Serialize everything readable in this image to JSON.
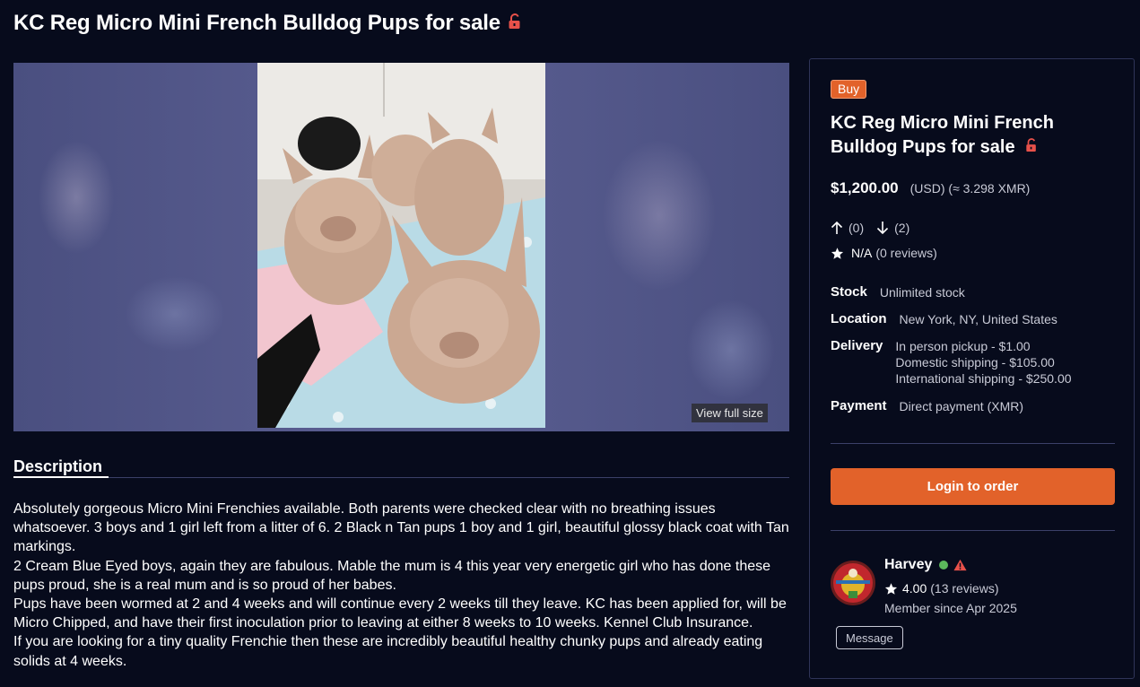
{
  "page": {
    "title": "KC Reg Micro Mini French Bulldog Pups for sale"
  },
  "gallery": {
    "view_full_label": "View full size"
  },
  "description": {
    "tab_label": "Description",
    "lines": [
      "Absolutely gorgeous Micro Mini Frenchies available. Both parents were checked clear with no breathing issues whatsoever. 3 boys and 1 girl left from a litter of 6. 2 Black n Tan pups 1 boy and 1 girl, beautiful glossy black coat with Tan markings.",
      "2 Cream Blue Eyed boys, again they are fabulous. Mable the mum is 4 this year very energetic girl who has done these pups proud, she is a real mum and is so proud of her babes.",
      "Pups have been wormed at 2 and 4 weeks and will continue every 2 weeks till they leave. KC has been applied for, will be Micro Chipped, and have their first inoculation prior to leaving at either 8 weeks to 10 weeks. Kennel Club Insurance.",
      "If you are looking for a tiny quality Frenchie then these are incredibly beautiful healthy chunky pups and already eating solids at 4 weeks."
    ]
  },
  "listing": {
    "badge": "Buy",
    "title": "KC Reg Micro Mini French Bulldog Pups for sale",
    "price": "$1,200.00",
    "price_sub": "(USD) (≈ 3.298 XMR)",
    "upvotes": "(0)",
    "downvotes": "(2)",
    "rating": "N/A",
    "reviews": "(0 reviews)",
    "stock_label": "Stock",
    "stock_value": "Unlimited stock",
    "location_label": "Location",
    "location_value": "New York, NY, United States",
    "delivery_label": "Delivery",
    "delivery_options": [
      "In person pickup - $1.00",
      "Domestic shipping - $105.00",
      "International shipping - $250.00"
    ],
    "payment_label": "Payment",
    "payment_value": "Direct payment (XMR)",
    "order_button": "Login to order"
  },
  "seller": {
    "name": "Harvey",
    "rating": "4.00",
    "reviews": "(13 reviews)",
    "member_since": "Member since Apr 2025",
    "message_button": "Message"
  },
  "colors": {
    "background": "#070b1c",
    "accent": "#e2622a",
    "lock": "#e8514a",
    "online": "#5cb85c"
  }
}
